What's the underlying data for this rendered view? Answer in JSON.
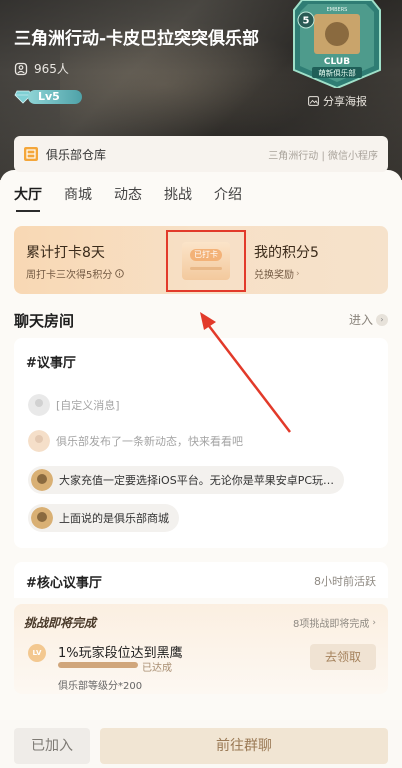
{
  "header": {
    "club_name": "三角洲行动-卡皮巴拉突突俱乐部",
    "member_count": "965人",
    "level": "Lv5",
    "badge": {
      "level": "5",
      "club_text": "CLUB",
      "name": "萌新俱乐部",
      "top_text": "EMBERS"
    },
    "share_poster": "分享海报",
    "icons": {
      "members": "person-icon",
      "level": "diamond-icon",
      "poster": "image-icon"
    }
  },
  "warehouse": {
    "label": "俱乐部仓库",
    "platform": "三角洲行动 | 微信小程序"
  },
  "tabs": [
    {
      "label": "大厅",
      "active": true
    },
    {
      "label": "商城",
      "active": false
    },
    {
      "label": "动态",
      "active": false
    },
    {
      "label": "挑战",
      "active": false
    },
    {
      "label": "介绍",
      "active": false
    }
  ],
  "checkin": {
    "title": "累计打卡8天",
    "subtitle": "周打卡三次得5积分",
    "stamp_label": "已打卡",
    "points_title": "我的积分5",
    "points_link": "兑换奖励"
  },
  "chat": {
    "section_title": "聊天房间",
    "enter_label": "进入",
    "room1": {
      "title": "#议事厅",
      "messages": [
        {
          "text": "[自定义消息]"
        },
        {
          "text": "俱乐部发布了一条新动态，快来看看吧"
        },
        {
          "text": "大家充值一定要选择iOS平台。无论你是苹果安卓PC玩…"
        },
        {
          "text": "上面说的是俱乐部商城"
        }
      ]
    },
    "room2": {
      "title": "#核心议事厅",
      "time": "8小时前活跃"
    }
  },
  "challenge": {
    "header": "挑战即将完成",
    "more": "8项挑战即将完成",
    "level_badge": "LV",
    "task": "1%玩家段位达到黑鹰",
    "status": "已达成",
    "progress": 1.0,
    "reward": "俱乐部等级分*200",
    "claim_label": "去领取"
  },
  "bottom": {
    "joined_label": "已加入",
    "goto_label": "前往群聊"
  },
  "colors": {
    "accent": "#e23a2a",
    "brand_warm": "#f8d8b4",
    "level_teal": "#4fa2a8"
  }
}
